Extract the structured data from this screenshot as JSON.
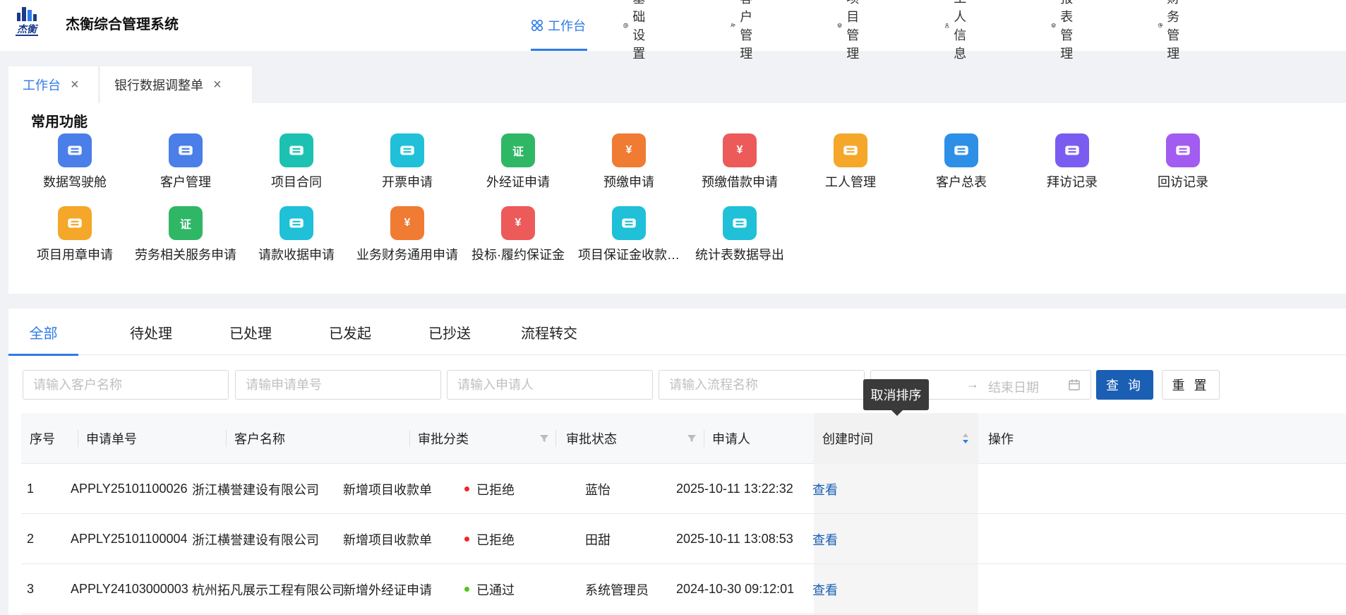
{
  "app": {
    "title": "杰衡综合管理系统",
    "logo_text": "杰衡"
  },
  "nav": {
    "items": [
      {
        "label": "工作台",
        "icon": "grid-icon",
        "active": true
      },
      {
        "label": "基础设置",
        "icon": "gear-icon"
      },
      {
        "label": "客户管理",
        "icon": "users-icon"
      },
      {
        "label": "项目管理",
        "icon": "layers-icon"
      },
      {
        "label": "工人信息",
        "icon": "user-icon"
      },
      {
        "label": "报表管理",
        "icon": "layers-icon"
      },
      {
        "label": "财务管理",
        "icon": "pie-icon"
      }
    ]
  },
  "page_tabs": [
    {
      "label": "工作台",
      "active": true
    },
    {
      "label": "银行数据调整单"
    }
  ],
  "common_functions": {
    "title": "常用功能",
    "items": [
      {
        "label": "数据驾驶舱",
        "icon": "chart-icon",
        "color": "#4a7ee8"
      },
      {
        "label": "客户管理",
        "icon": "contact-card-icon",
        "color": "#4a7ee8"
      },
      {
        "label": "项目合同",
        "icon": "stack-icon",
        "color": "#1cc1b2"
      },
      {
        "label": "开票申请",
        "icon": "ticket-icon",
        "color": "#1fc0d8"
      },
      {
        "label": "外经证申请",
        "icon": "certificate-icon",
        "color": "#2fb766",
        "glyph": "证"
      },
      {
        "label": "预缴申请",
        "icon": "coin-icon",
        "color": "#f07b33",
        "glyph": "¥"
      },
      {
        "label": "预缴借款申请",
        "icon": "loan-icon",
        "color": "#ec5a5a",
        "glyph": "¥"
      },
      {
        "label": "工人管理",
        "icon": "worker-icon",
        "color": "#f4a729"
      },
      {
        "label": "客户总表",
        "icon": "pie-chart-icon",
        "color": "#2d8fe6"
      },
      {
        "label": "拜访记录",
        "icon": "running-person-icon",
        "color": "#7a5cf0"
      },
      {
        "label": "回访记录",
        "icon": "phone-icon",
        "color": "#a25cf0"
      },
      {
        "label": "项目用章申请",
        "icon": "stamp-icon",
        "color": "#f4a729"
      },
      {
        "label": "劳务相关服务申请",
        "icon": "certificate-icon",
        "color": "#2fb766",
        "glyph": "证"
      },
      {
        "label": "请款收据申请",
        "icon": "ticket-icon",
        "color": "#1fc0d8"
      },
      {
        "label": "业务财务通用申请",
        "icon": "coin-icon",
        "color": "#f07b33",
        "glyph": "¥"
      },
      {
        "label": "投标·履约保证金",
        "icon": "loan-icon",
        "color": "#ec5a5a",
        "glyph": "¥"
      },
      {
        "label": "项目保证金收款…",
        "icon": "ticket-icon",
        "color": "#1fc0d8"
      },
      {
        "label": "统计表数据导出",
        "icon": "ticket-icon",
        "color": "#1fc0d8"
      }
    ]
  },
  "workflow": {
    "tabs": [
      {
        "label": "全部",
        "active": true
      },
      {
        "label": "待处理"
      },
      {
        "label": "已处理"
      },
      {
        "label": "已发起"
      },
      {
        "label": "已抄送"
      },
      {
        "label": "流程转交"
      }
    ],
    "filters": {
      "customer_placeholder": "请输入客户名称",
      "apply_no_placeholder": "请输申请单号",
      "applicant_placeholder": "请输入申请人",
      "flow_placeholder": "请输入流程名称",
      "date_arrow": "→",
      "date_end_placeholder": "结束日期",
      "query_label": "查 询",
      "reset_label": "重 置"
    },
    "tooltip": "取消排序",
    "columns": [
      "序号",
      "申请单号",
      "客户名称",
      "审批分类",
      "审批状态",
      "申请人",
      "创建时间",
      "操作"
    ],
    "rows": [
      {
        "index": "1",
        "apply_no": "APPLY25101100026",
        "customer": "浙江横誉建设有限公司",
        "category": "新增项目收款单",
        "status": "已拒绝",
        "status_color": "#f5222d",
        "applicant": "蓝怡",
        "created": "2025-10-11 13:22:32",
        "action": "查看"
      },
      {
        "index": "2",
        "apply_no": "APPLY25101100004",
        "customer": "浙江横誉建设有限公司",
        "category": "新增项目收款单",
        "status": "已拒绝",
        "status_color": "#f5222d",
        "applicant": "田甜",
        "created": "2025-10-11 13:08:53",
        "action": "查看"
      },
      {
        "index": "3",
        "apply_no": "APPLY24103000003",
        "customer": "杭州拓凡展示工程有限公司",
        "category": "新增外经证申请",
        "status": "已通过",
        "status_color": "#52c41a",
        "applicant": "系统管理员",
        "created": "2024-10-30 09:12:01",
        "action": "查看"
      }
    ]
  }
}
